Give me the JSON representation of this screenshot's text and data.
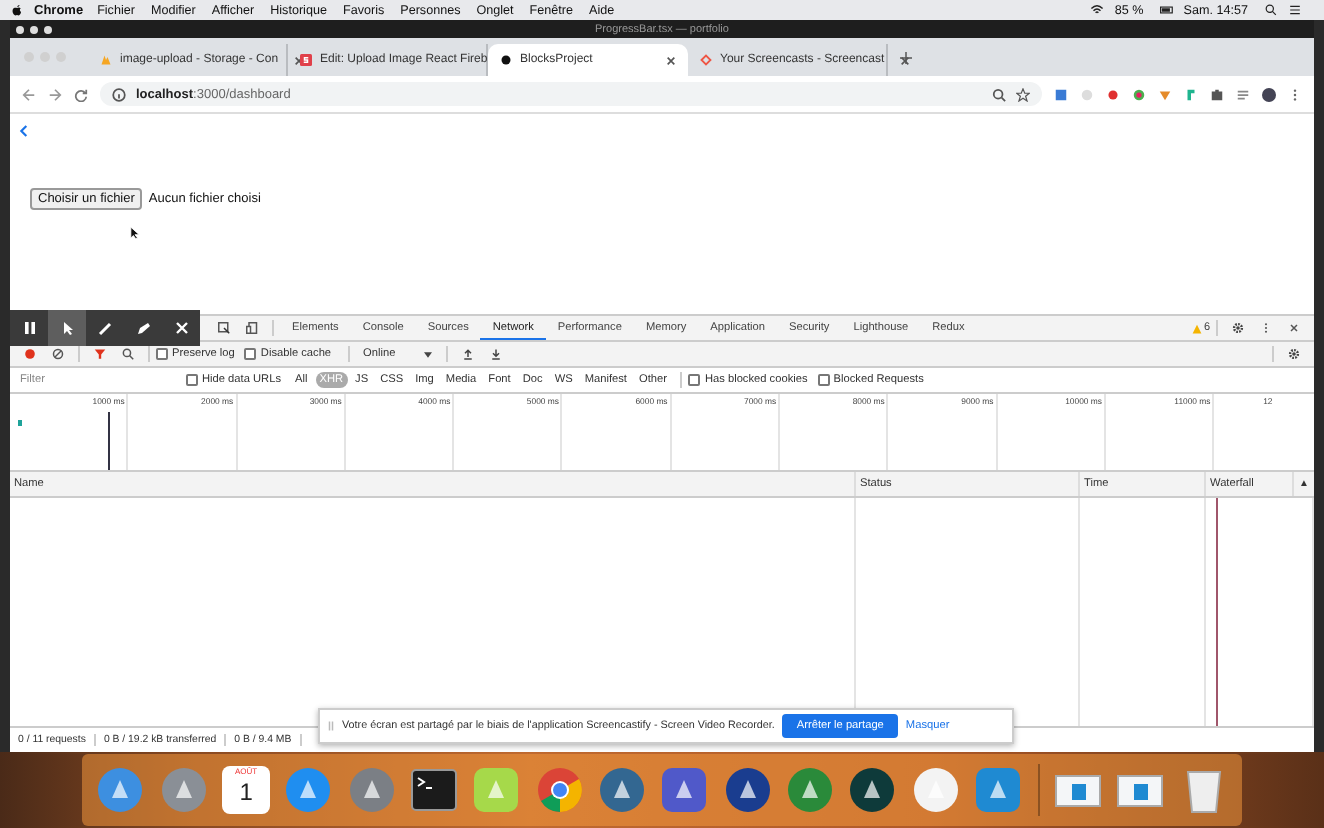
{
  "menubar": {
    "app": "Chrome",
    "items": [
      "Fichier",
      "Modifier",
      "Afficher",
      "Historique",
      "Favoris",
      "Personnes",
      "Onglet",
      "Fenêtre",
      "Aide"
    ],
    "battery": "85 %",
    "clock": "Sam. 14:57"
  },
  "window": {
    "title": "ProgressBar.tsx — portfolio"
  },
  "tabs": [
    {
      "label": "image-upload - Storage - Con",
      "kind": "fire",
      "selected": false
    },
    {
      "label": "Edit: Upload Image React Fireb",
      "kind": "letter",
      "selected": false
    },
    {
      "label": "BlocksProject",
      "kind": "dot",
      "selected": true
    },
    {
      "label": "Your Screencasts - Screencast",
      "kind": "cast",
      "selected": false
    }
  ],
  "address": {
    "host": "localhost",
    "path": ":3000/dashboard"
  },
  "page": {
    "file_button": "Choisir un fichier",
    "file_status": "Aucun fichier choisi"
  },
  "draw_tools": [
    {
      "kind": "pause",
      "selected": false
    },
    {
      "kind": "pointer",
      "selected": true
    },
    {
      "kind": "pen",
      "selected": false
    },
    {
      "kind": "marker",
      "selected": false
    },
    {
      "kind": "close",
      "selected": false
    }
  ],
  "devtools": {
    "tabs": [
      {
        "label": "Elements",
        "selected": false
      },
      {
        "label": "Console",
        "selected": false
      },
      {
        "label": "Sources",
        "selected": false
      },
      {
        "label": "Network",
        "selected": true
      },
      {
        "label": "Performance",
        "selected": false
      },
      {
        "label": "Memory",
        "selected": false
      },
      {
        "label": "Application",
        "selected": false
      },
      {
        "label": "Security",
        "selected": false
      },
      {
        "label": "Lighthouse",
        "selected": false
      },
      {
        "label": "Redux",
        "selected": false
      }
    ],
    "warnings": "6",
    "preserve_log": {
      "label": "Preserve log",
      "checked": false
    },
    "disable_cache": {
      "label": "Disable cache",
      "checked": false
    },
    "throttle": "Online",
    "filter": {
      "placeholder": "Filter"
    },
    "hide_data_urls": {
      "label": "Hide data URLs",
      "checked": false
    },
    "types": [
      {
        "label": "All",
        "selected": false
      },
      {
        "label": "XHR",
        "selected": true
      },
      {
        "label": "JS",
        "selected": false
      },
      {
        "label": "CSS",
        "selected": false
      },
      {
        "label": "Img",
        "selected": false
      },
      {
        "label": "Media",
        "selected": false
      },
      {
        "label": "Font",
        "selected": false
      },
      {
        "label": "Doc",
        "selected": false
      },
      {
        "label": "WS",
        "selected": false
      },
      {
        "label": "Manifest",
        "selected": false
      },
      {
        "label": "Other",
        "selected": false
      }
    ],
    "has_blocked_cookies": {
      "label": "Has blocked cookies",
      "checked": false
    },
    "blocked_requests": {
      "label": "Blocked Requests",
      "checked": false
    },
    "ticks": [
      "1000 ms",
      "2000 ms",
      "3000 ms",
      "4000 ms",
      "5000 ms",
      "6000 ms",
      "7000 ms",
      "8000 ms",
      "9000 ms",
      "10000 ms",
      "11000 ms",
      "12"
    ],
    "columns": [
      "Name",
      "Status",
      "Time",
      "Waterfall"
    ],
    "sort_arrow": "▲",
    "status": [
      "0 / 11 requests",
      "0 B / 19.2 kB transferred",
      "0 B / 9.4 MB"
    ]
  },
  "notification": {
    "message": "Votre écran est partagé par le biais de l'application Screencastify - Screen Video Recorder.",
    "button": "Arrêter le partage",
    "link": "Masquer"
  },
  "dock": [
    {
      "kind": "finder"
    },
    {
      "kind": "rocket"
    },
    {
      "kind": "calendar",
      "month": "AOÛT",
      "day": "1"
    },
    {
      "kind": "appstore"
    },
    {
      "kind": "settings"
    },
    {
      "kind": "terminal"
    },
    {
      "kind": "cube"
    },
    {
      "kind": "chrome"
    },
    {
      "kind": "elephant"
    },
    {
      "kind": "teams"
    },
    {
      "kind": "dropbox"
    },
    {
      "kind": "green-rocket"
    },
    {
      "kind": "octo"
    },
    {
      "kind": "music"
    },
    {
      "kind": "vscode"
    },
    {
      "kind": "separator"
    },
    {
      "kind": "window"
    },
    {
      "kind": "window"
    },
    {
      "kind": "trash"
    }
  ]
}
